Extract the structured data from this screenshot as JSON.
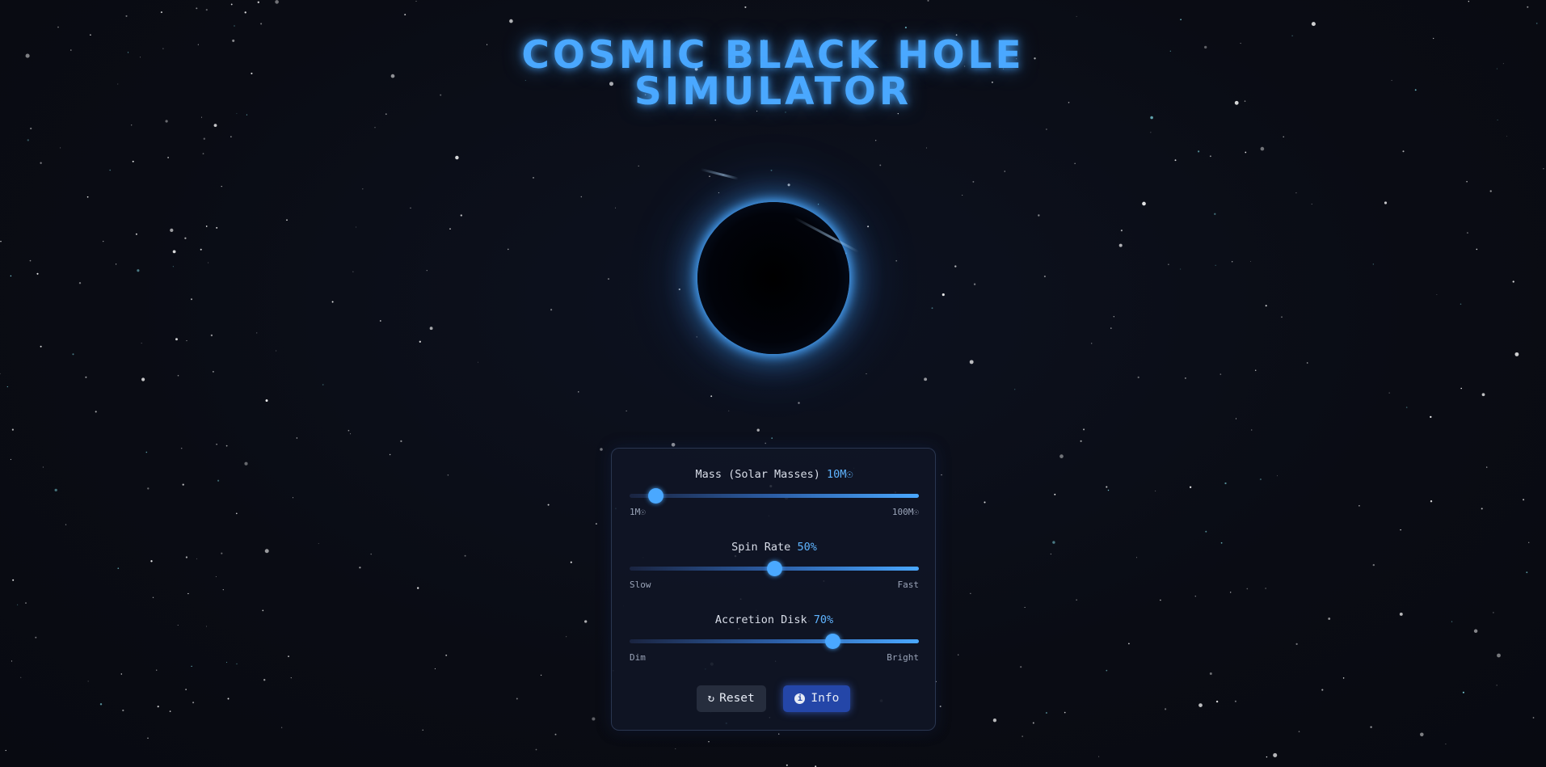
{
  "title": {
    "line1": "COSMIC BLACK HOLE",
    "line2": "SIMULATOR"
  },
  "colors": {
    "accent": "#4aa8ff",
    "background": "#0a0c14",
    "panel": "#101626",
    "info_button": "#2446a8",
    "reset_button": "#262d3d"
  },
  "controls": {
    "mass": {
      "label": "Mass (Solar Masses)",
      "value_text": "10M☉",
      "level": 0.09,
      "min_label": "1M☉",
      "max_label": "100M☉"
    },
    "spin": {
      "label": "Spin Rate",
      "value_text": "50%",
      "level": 0.5,
      "min_label": "Slow",
      "max_label": "Fast"
    },
    "disk": {
      "label": "Accretion Disk",
      "value_text": "70%",
      "level": 0.7,
      "min_label": "Dim",
      "max_label": "Bright"
    }
  },
  "buttons": {
    "reset": {
      "label": "Reset",
      "icon": "refresh-icon"
    },
    "info": {
      "label": "Info",
      "icon": "info-icon"
    }
  }
}
